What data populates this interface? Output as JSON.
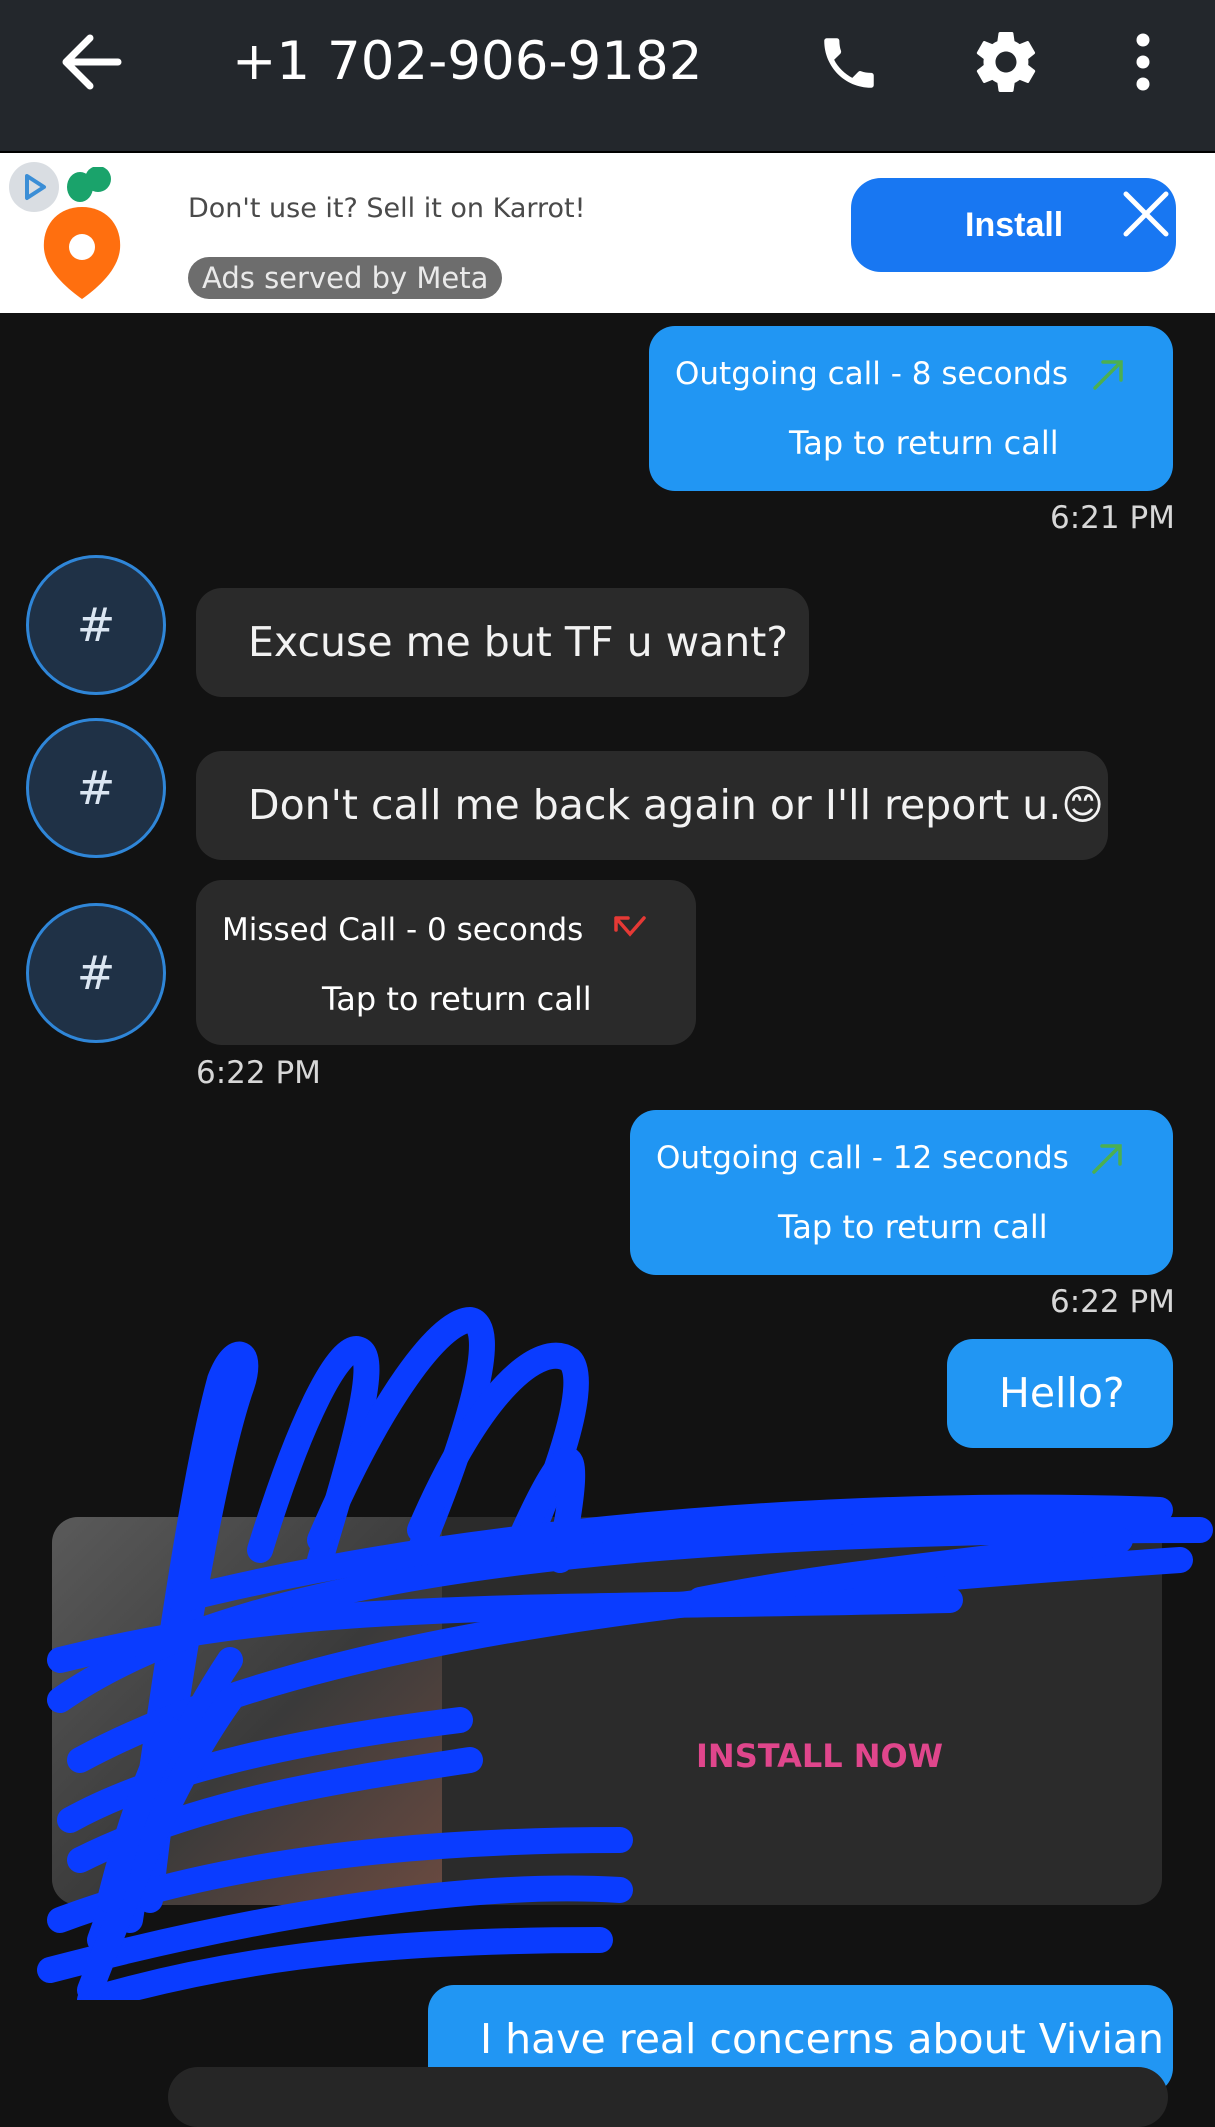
{
  "header": {
    "title": "+1 702-906-9182",
    "icons": [
      "back-arrow-icon",
      "phone-icon",
      "gear-icon",
      "more-vertical-icon"
    ]
  },
  "ad_banner": {
    "tagline": "Don't use it? Sell it on Karrot!",
    "meta_label": "Ads served by Meta",
    "install_label": "Install",
    "brand_color": "#1877f2"
  },
  "messages": {
    "m1": {
      "head": "Outgoing call  -  8 seconds",
      "sub": "Tap to return call",
      "time": "6:21 PM"
    },
    "m2": {
      "avatar": "#",
      "text": "Excuse me but TF u want?"
    },
    "m3": {
      "avatar": "#",
      "text": "Don't call me back again or I'll report u.😊"
    },
    "m4": {
      "avatar": "#",
      "head": "Missed Call  -  0 seconds",
      "sub": "Tap to return call",
      "time": "6:22 PM"
    },
    "m5": {
      "head": "Outgoing call  -  12 seconds",
      "sub": "Tap to return call",
      "time": "6:22 PM"
    },
    "m6": {
      "text": "Hello?"
    },
    "m7": {
      "text": "I have real concerns about Vivian"
    }
  },
  "ad_card": {
    "cta": "INSTALL NOW"
  },
  "colors": {
    "outgoing": "#2196f3",
    "incoming": "#2a2a2a",
    "missed_icon": "#e53935",
    "outgoing_icon": "#4caf50",
    "scribble": "#0a3cff"
  }
}
